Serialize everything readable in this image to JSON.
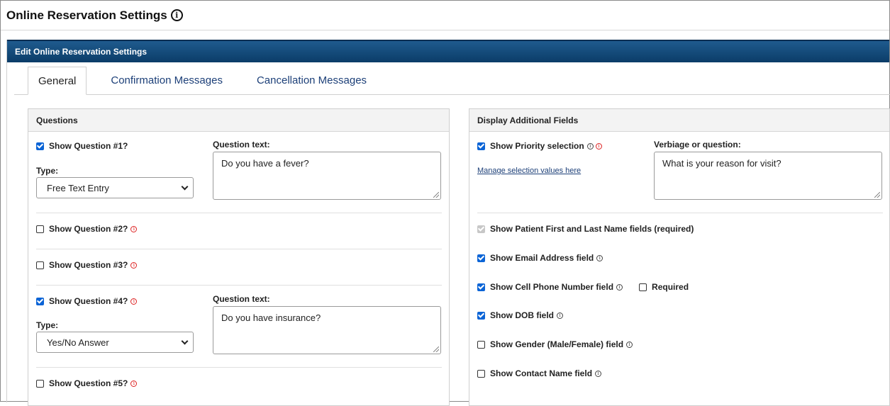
{
  "page": {
    "title": "Online Reservation Settings"
  },
  "panel": {
    "header": "Edit Online Reservation Settings"
  },
  "tabs": [
    "General",
    "Confirmation Messages",
    "Cancellation Messages"
  ],
  "questions": {
    "title": "Questions",
    "q1": {
      "label": "Show Question #1?",
      "checked": true,
      "text_label": "Question text:",
      "text": "Do you have a fever?",
      "type_label": "Type:",
      "type": "Free Text Entry"
    },
    "q2": {
      "label": "Show Question #2?",
      "checked": false
    },
    "q3": {
      "label": "Show Question #3?",
      "checked": false
    },
    "q4": {
      "label": "Show Question #4?",
      "checked": true,
      "text_label": "Question text:",
      "text": "Do you have insurance?",
      "type_label": "Type:",
      "type": "Yes/No Answer"
    },
    "q5": {
      "label": "Show Question #5?",
      "checked": false
    }
  },
  "additional": {
    "title": "Display Additional Fields",
    "priority": {
      "label": "Show Priority selection",
      "checked": true
    },
    "manage_link": "Manage selection values here",
    "verbiage_label": "Verbiage or question:",
    "verbiage_text": "What is your reason for visit?",
    "patient_name": {
      "label": "Show Patient First and Last Name fields (required)",
      "checked": true,
      "disabled": true
    },
    "email": {
      "label": "Show Email Address field",
      "checked": true
    },
    "cell": {
      "label": "Show Cell Phone Number field",
      "checked": true
    },
    "required": {
      "label": "Required",
      "checked": false
    },
    "dob": {
      "label": "Show DOB field",
      "checked": true
    },
    "gender": {
      "label": "Show Gender (Male/Female) field",
      "checked": false
    },
    "contact": {
      "label": "Show Contact Name field",
      "checked": false
    }
  },
  "colors": {
    "header_bar": "#0b3c68",
    "checkbox": "#0b64d6",
    "link": "#1c3f78",
    "warning": "#dd2222"
  }
}
